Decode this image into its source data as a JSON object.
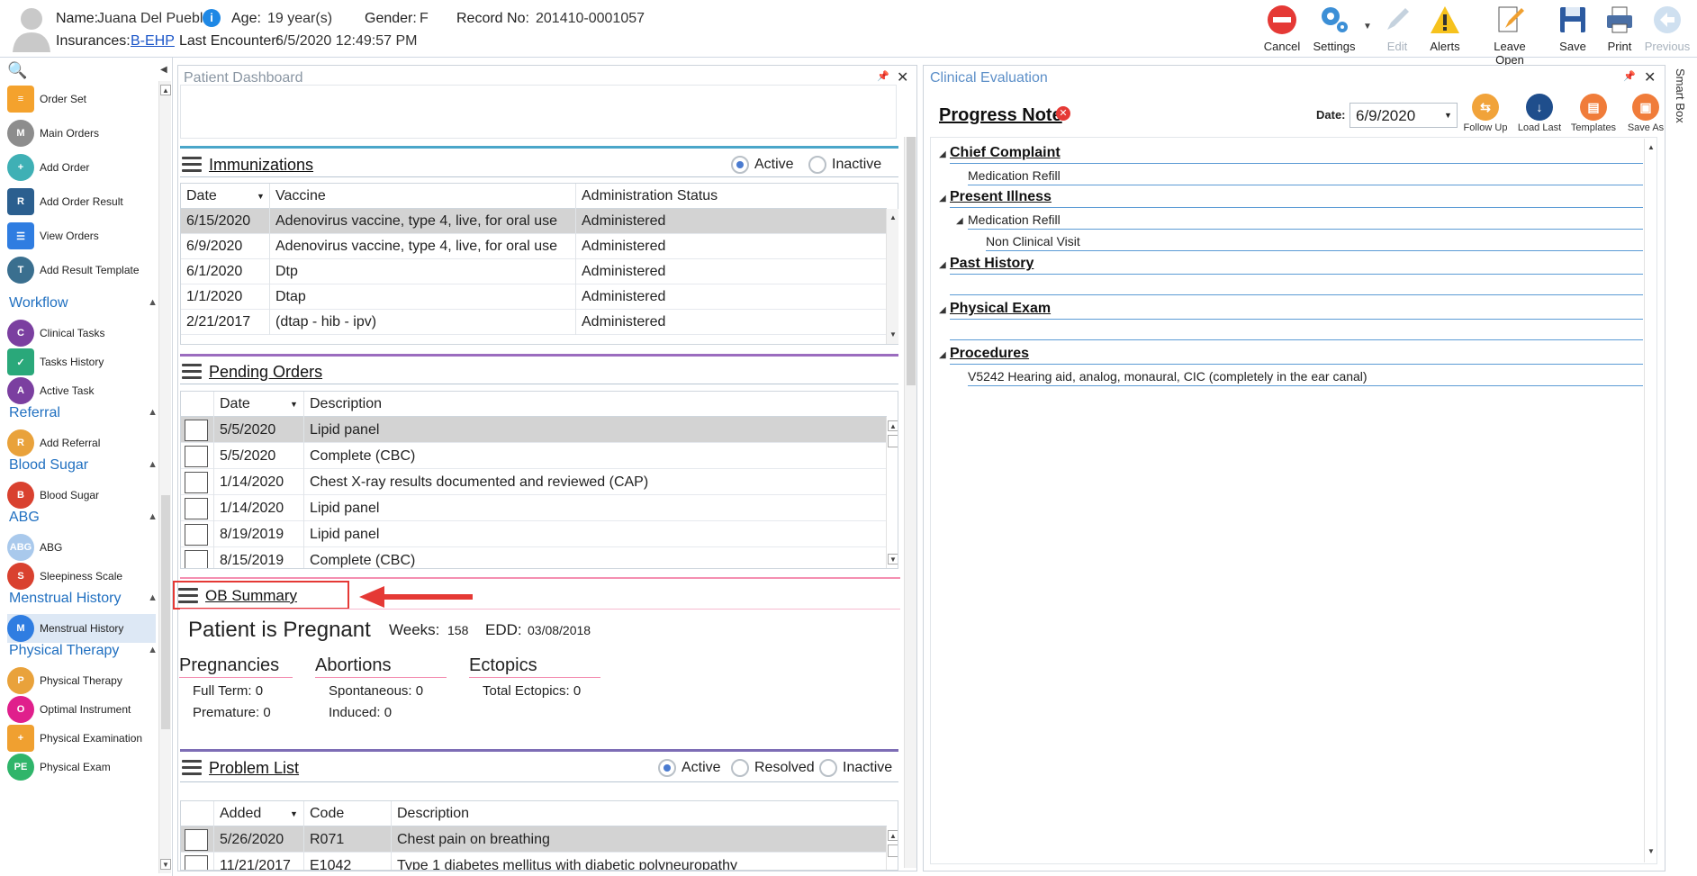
{
  "patient": {
    "name_label": "Name:",
    "name": "Juana Del Pueblo",
    "age_label": "Age:",
    "age": "19 year(s)",
    "gender_label": "Gender:",
    "gender": "F",
    "record_label": "Record No:",
    "record_no": "201410-0001057",
    "insurances_label": "Insurances:",
    "insurance": "B-EHP",
    "last_encounter_label": "Last Encounter:",
    "last_encounter": "6/5/2020 12:49:57 PM"
  },
  "toolbar": {
    "cancel": "Cancel",
    "settings": "Settings",
    "edit": "Edit",
    "alerts": "Alerts",
    "leave_open": "Leave Open",
    "save": "Save",
    "print": "Print",
    "previous": "Previous"
  },
  "sidebar": {
    "items_top": [
      "Order Set",
      "Main Orders",
      "Add Order",
      "Add Order Result",
      "View Orders",
      "Add Result Template"
    ],
    "workflow": {
      "title": "Workflow",
      "items": [
        "Clinical Tasks",
        "Tasks History",
        "Active Task"
      ]
    },
    "referral": {
      "title": "Referral",
      "items": [
        "Add Referral"
      ]
    },
    "blood_sugar": {
      "title": "Blood Sugar",
      "items": [
        "Blood Sugar"
      ]
    },
    "abg": {
      "title": "ABG",
      "items": [
        "ABG",
        "Sleepiness Scale"
      ]
    },
    "menstrual": {
      "title": "Menstrual History",
      "items": [
        "Menstrual History"
      ]
    },
    "physical": {
      "title": "Physical Therapy",
      "items": [
        "Physical Therapy",
        "Optimal Instrument",
        "Physical Examination",
        "Physical Exam"
      ]
    },
    "icon_abg": "ABG",
    "icon_pe": "PE"
  },
  "dashboard": {
    "title": "Patient Dashboard",
    "immunizations": {
      "title": "Immunizations",
      "filter_active": "Active",
      "filter_inactive": "Inactive",
      "columns": [
        "Date",
        "Vaccine",
        "Administration Status"
      ],
      "rows": [
        [
          "6/15/2020",
          "Adenovirus vaccine, type 4, live, for oral use",
          "Administered"
        ],
        [
          "6/9/2020",
          "Adenovirus vaccine, type 4, live, for oral use",
          "Administered"
        ],
        [
          "6/1/2020",
          "Dtp",
          "Administered"
        ],
        [
          "1/1/2020",
          "Dtap",
          "Administered"
        ],
        [
          "2/21/2017",
          "(dtap - hib - ipv)",
          "Administered"
        ]
      ]
    },
    "pending_orders": {
      "title": "Pending Orders",
      "columns": [
        "Date",
        "Description"
      ],
      "rows": [
        [
          "5/5/2020",
          "Lipid panel"
        ],
        [
          "5/5/2020",
          "Complete (CBC)"
        ],
        [
          "1/14/2020",
          "Chest X-ray results documented and reviewed (CAP)"
        ],
        [
          "1/14/2020",
          "Lipid panel"
        ],
        [
          "8/19/2019",
          "Lipid panel"
        ],
        [
          "8/15/2019",
          "Complete (CBC)"
        ]
      ]
    },
    "ob_summary": {
      "title": "OB Summary",
      "status": "Patient is Pregnant",
      "weeks_label": "Weeks:",
      "weeks": "158",
      "edd_label": "EDD:",
      "edd": "03/08/2018",
      "pregnancies": {
        "title": "Pregnancies",
        "full_term": "Full Term: 0",
        "premature": "Premature: 0"
      },
      "abortions": {
        "title": "Abortions",
        "spontaneous": "Spontaneous: 0",
        "induced": "Induced: 0"
      },
      "ectopics": {
        "title": "Ectopics",
        "total": "Total Ectopics: 0"
      }
    },
    "problem_list": {
      "title": "Problem List",
      "filter_active": "Active",
      "filter_resolved": "Resolved",
      "filter_inactive": "Inactive",
      "columns": [
        "Added",
        "Code",
        "Description"
      ],
      "rows": [
        [
          "5/26/2020",
          "R071",
          "Chest pain on breathing"
        ],
        [
          "11/21/2017",
          "E1042",
          "Type 1 diabetes mellitus with diabetic polyneuropathy"
        ]
      ]
    }
  },
  "clinical": {
    "title": "Clinical Evaluation",
    "note_title": "Progress Note",
    "date_label": "Date:",
    "date_value": "6/9/2020",
    "buttons": [
      "Follow Up",
      "Load Last",
      "Templates",
      "Save As"
    ],
    "sections": {
      "chief_complaint": {
        "title": "Chief Complaint",
        "text": "Medication Refill"
      },
      "present_illness": {
        "title": "Present Illness",
        "sub": "Medication Refill",
        "sub_text": "Non Clinical Visit"
      },
      "past_history": {
        "title": "Past History"
      },
      "physical_exam": {
        "title": "Physical Exam"
      },
      "procedures": {
        "title": "Procedures",
        "text": "V5242 Hearing aid, analog, monaural, CIC (completely in the ear canal)"
      }
    }
  },
  "smart_box": "Smart Box",
  "colors": {
    "accent": "#1f6fc0",
    "highlight_box": "#e53935",
    "selected_row": "#d3d3d3"
  }
}
